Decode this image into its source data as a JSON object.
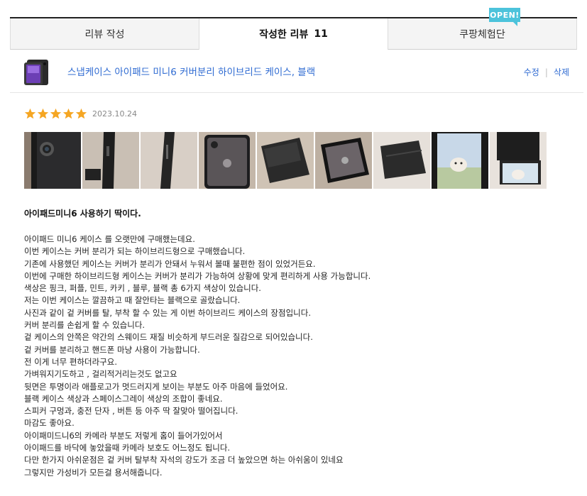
{
  "tabs": [
    {
      "label": "리뷰 작성"
    },
    {
      "label": "작성한 리뷰",
      "count": "11"
    },
    {
      "label": "쿠팡체험단"
    }
  ],
  "open_badge": "OPEN!",
  "product": {
    "name": "스냅케이스 아이패드 미니6 커버분리 하이브리드 케이스, 블랙",
    "edit": "수정",
    "delete": "삭제"
  },
  "review": {
    "rating": 5,
    "date": "2023.10.24",
    "headline": "아이패드미니6 사용하기 딱이다.",
    "lines": [
      "아이패드 미니6 케이스 를 오랫만에 구매했는데요.",
      "이번 케이스는 커버 분리가 되는 하이브리드형으로 구매했습니다.",
      "기존에 사용했던 케이스는 커버가 분리가 안돼서 누워서 볼때  불편한 점이 있었거든요.",
      "이번에 구매한 하이브리드형 케이스는 커버가 분리가 가능하여  상황에 맞게 편리하게 사용 가능합니다.",
      "색상은 핑크, 퍼플, 민트, 카키 , 블루, 블랙 총 6가지 색상이 있습니다.",
      "저는 이번  케이스는 깔끔하고 때 잘안타는 블랙으로 골랐습니다.",
      "사진과 같이 겉 커버를 탈, 부착 할 수  있는 게 이번 하이브리드 케이스의 장점입니다.",
      "커버 분리를 손쉽게 할 수 있습니다.",
      "겉 케이스의 안쪽은 약간의 스웨이드 재질 비슷하게 부드러운 질감으로 되어있습니다.",
      "겉 커버를 분리하고 핸드폰 마냥 사용이 가능합니다.",
      "전 이게 너무 편하더라구요.",
      "가벼워지기도하고 ,  걸리적거리는것도 없고요",
      "뒷면은 투명이라  애플로고가 멋드러지게 보이는 부분도 아주 마음에 들었어요.",
      "블랙 케이스 색상과 스페이스그레이 색상의 조합이 좋네요.",
      "스피커 구멍과, 충전 단자 , 버튼 등 아주 딱 잘맞아 떨어집니다.",
      "마감도 좋아요.",
      "아이패미드니6의 카메라 부분도 저렇게  홈이 들어가있어서",
      "아이패드를 바닥에 놓았을때 카메라 보호도 어느정도 됩니다.",
      "다만 한가지 아쉬운점은  겉 커버 탈부착 자석의 강도가 조금 더 높았으면 하는 아쉬움이 있네요",
      "그렇지만 가성비가 모든걸 용서해줍니다."
    ]
  },
  "photos": [
    {
      "icon": "case-back-camera-photo"
    },
    {
      "icon": "case-edge-photo"
    },
    {
      "icon": "case-side-photo"
    },
    {
      "icon": "case-back-apple-logo-photo"
    },
    {
      "icon": "cover-folded-photo"
    },
    {
      "icon": "case-transparent-back-photo"
    },
    {
      "icon": "cover-closed-photo"
    },
    {
      "icon": "ipad-screen-dog-photo"
    },
    {
      "icon": "ipad-stand-dog-photo"
    }
  ],
  "colors": {
    "accent_blue": "#2f6bd2",
    "star_orange": "#f5a623",
    "badge_cyan": "#4cc3db"
  }
}
